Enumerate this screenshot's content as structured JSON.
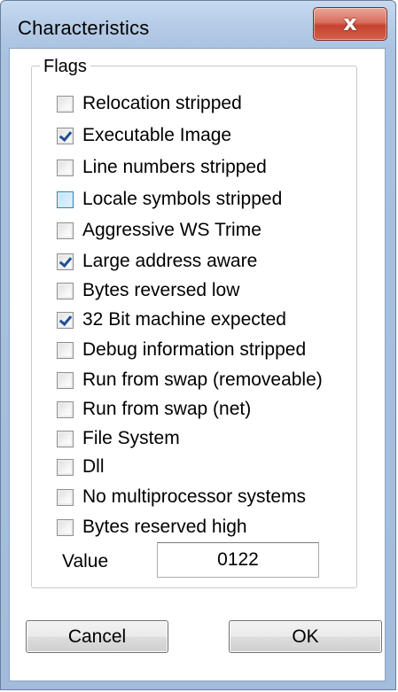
{
  "window": {
    "title": "Characteristics",
    "close_glyph": "x"
  },
  "group": {
    "legend": "Flags"
  },
  "flags": [
    {
      "label": "Relocation stripped",
      "checked": false,
      "hover": false
    },
    {
      "label": "Executable Image",
      "checked": true,
      "hover": false
    },
    {
      "label": "Line numbers stripped",
      "checked": false,
      "hover": false
    },
    {
      "label": "Locale symbols stripped",
      "checked": false,
      "hover": true
    },
    {
      "label": "Aggressive WS Trime",
      "checked": false,
      "hover": false
    },
    {
      "label": "Large address aware",
      "checked": true,
      "hover": false
    },
    {
      "label": "Bytes reversed low",
      "checked": false,
      "hover": false
    },
    {
      "label": "32 Bit machine expected",
      "checked": true,
      "hover": false
    },
    {
      "label": "Debug information stripped",
      "checked": false,
      "hover": false
    },
    {
      "label": "Run from swap (removeable)",
      "checked": false,
      "hover": false
    },
    {
      "label": "Run from swap (net)",
      "checked": false,
      "hover": false
    },
    {
      "label": "File System",
      "checked": false,
      "hover": false
    },
    {
      "label": "Dll",
      "checked": false,
      "hover": false
    },
    {
      "label": "No multiprocessor systems",
      "checked": false,
      "hover": false
    },
    {
      "label": "Bytes reserved high",
      "checked": false,
      "hover": false
    }
  ],
  "value_field": {
    "label": "Value",
    "value": "0122"
  },
  "buttons": {
    "cancel": "Cancel",
    "ok": "OK"
  },
  "colors": {
    "checkmark": "#1f4f96",
    "close_button": "#c5422f",
    "titlebar": "#b4cbe6"
  }
}
